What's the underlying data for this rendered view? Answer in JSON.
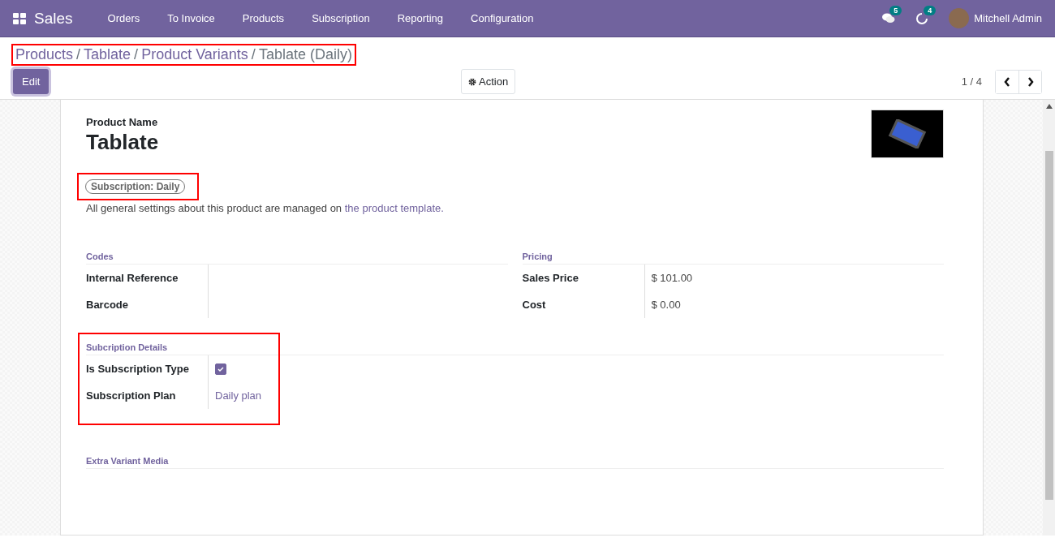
{
  "navbar": {
    "app_name": "Sales",
    "menu": [
      "Orders",
      "To Invoice",
      "Products",
      "Subscription",
      "Reporting",
      "Configuration"
    ],
    "messages_count": "5",
    "activities_count": "4",
    "user_name": "Mitchell Admin"
  },
  "breadcrumb": {
    "highlighted": true,
    "separator": "/",
    "items": [
      {
        "label": "Products",
        "selected": false
      },
      {
        "label": "Tablate",
        "selected": false
      },
      {
        "label": "Product Variants",
        "selected": false
      },
      {
        "label": "Tablate (Daily)",
        "selected": true
      }
    ]
  },
  "buttons": {
    "edit": "Edit",
    "action": "Action"
  },
  "pager": {
    "value": "1 / 4"
  },
  "product": {
    "name_label": "Product Name",
    "name": "Tablate",
    "tag": {
      "label": "Subscription: Daily",
      "highlighted": true
    },
    "note": "All general settings about this product are managed on",
    "note_link": "the product template."
  },
  "groups": [
    {
      "title": "Codes",
      "highlighted": false,
      "fields": [
        {
          "kind": "text",
          "label": "Internal Reference"
        },
        {
          "kind": "text",
          "label": "Barcode"
        }
      ]
    },
    {
      "title": "Pricing",
      "highlighted": false,
      "fields": [
        {
          "kind": "text",
          "label": "Sales Price",
          "value": "$ 101.00"
        },
        {
          "kind": "text",
          "label": "Cost",
          "value": "$ 0.00"
        }
      ]
    },
    {
      "title": "Subcription Details",
      "highlighted": true,
      "fields": [
        {
          "kind": "checkbox",
          "label": "Is Subscription Type",
          "checked": true
        },
        {
          "kind": "link",
          "label": "Subscription Plan",
          "value": "Daily plan"
        }
      ]
    }
  ],
  "media_section": {
    "title": "Extra Variant Media"
  }
}
